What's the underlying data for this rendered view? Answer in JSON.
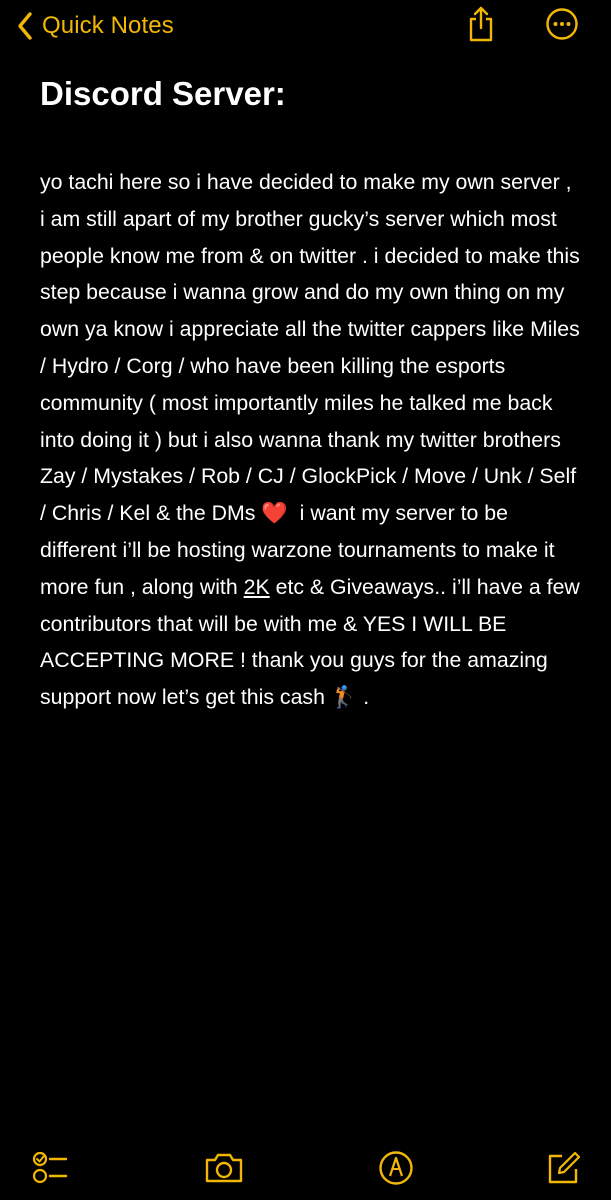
{
  "nav": {
    "back_label": "Quick Notes",
    "back_icon": "chevron-left-icon",
    "share_icon": "share-icon",
    "more_icon": "ellipsis-circle-icon"
  },
  "note": {
    "title": "Discord Server:",
    "body_part1": "yo tachi here so i have decided to make my own server , i am still apart of my brother gucky’s server which most people know me from & on twitter . i decided to make this step because i wanna grow and do my own thing on my own ya know i appreciate all the twitter cappers like Miles / Hydro / Corg / who have been killing the esports community ( most importantly miles he talked me back into doing it ) but i also wanna thank my twitter brothers Zay / Mystakes / Rob / CJ / GlockPick / Move / Unk / Self / Chris / Kel & the DMs ",
    "heart_emoji": "❤️",
    "body_part2": "  i want my server to be different i’ll be hosting warzone tournaments to make it more fun , along with ",
    "underlined_text": "2K",
    "body_part3": " etc & Giveaways.. i’ll have a few contributors that will be with me & YES I WILL BE ACCEPTING MORE ! thank you guys for the amazing support now let’s get this cash ",
    "golfer_emoji": "🏌🏽",
    "body_end": " ."
  },
  "toolbar": {
    "checklist_icon": "checklist-icon",
    "camera_icon": "camera-icon",
    "markup_icon": "markup-pen-icon",
    "compose_icon": "compose-icon"
  },
  "colors": {
    "accent": "#f2b705",
    "background": "#000000",
    "text": "#ffffff"
  }
}
